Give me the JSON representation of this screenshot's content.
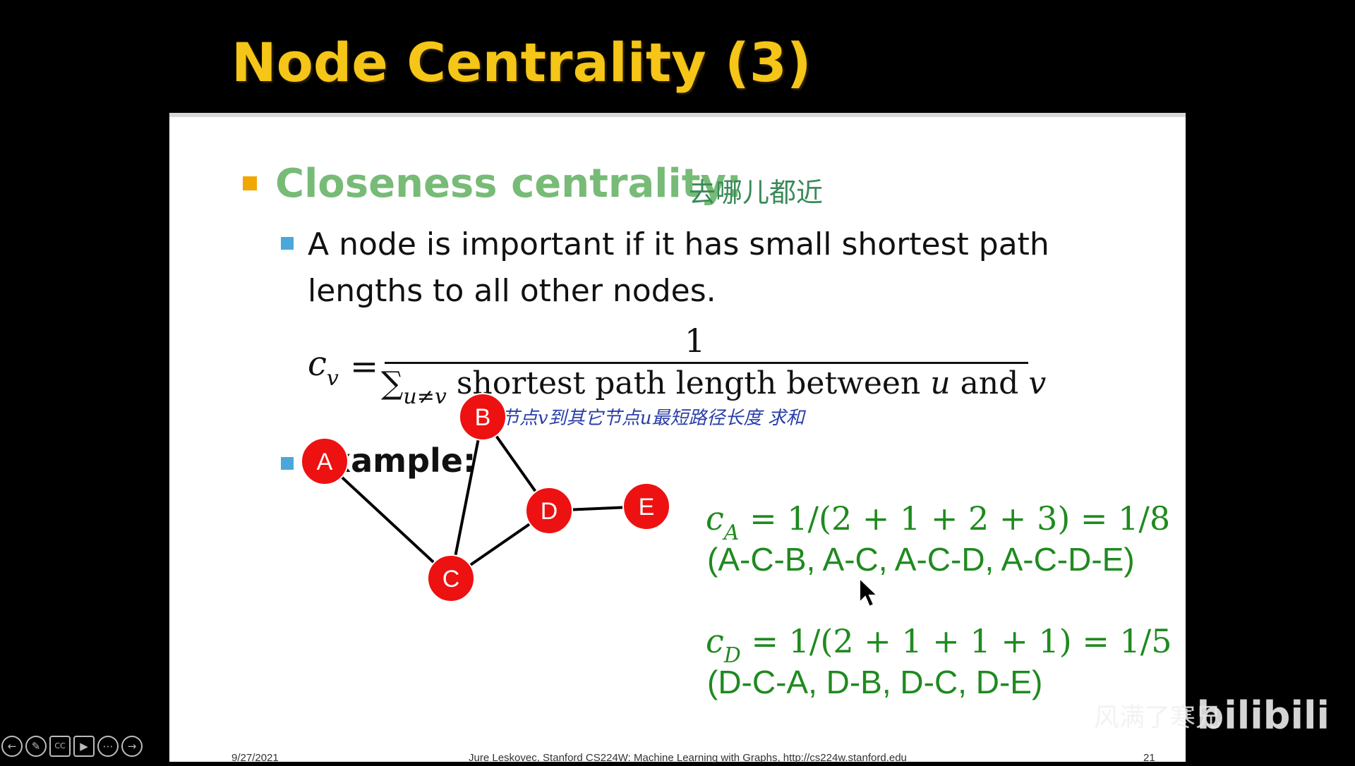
{
  "slide": {
    "title": "Node Centrality (3)",
    "heading": "Closeness centrality:",
    "heading_note": "去哪儿都近",
    "description": "A node is important if it has small shortest path lengths to all other nodes.",
    "formula": {
      "lhs": "c",
      "lhs_sub": "v",
      "equals": "=",
      "numerator": "1",
      "denominator_sum": "∑",
      "denominator_sub": "u≠v",
      "denominator_text": "shortest path length between",
      "var_u": "u",
      "and": "and",
      "var_v": "v",
      "note": "节点v到其它节点u最短路径长度 求和"
    },
    "example_label": "Example:",
    "graph": {
      "nodes": [
        "A",
        "B",
        "C",
        "D",
        "E"
      ],
      "edges": [
        [
          "A",
          "C"
        ],
        [
          "B",
          "C"
        ],
        [
          "B",
          "D"
        ],
        [
          "C",
          "D"
        ],
        [
          "D",
          "E"
        ]
      ],
      "node_color": "#ee1111"
    },
    "results": [
      {
        "lhs": "c",
        "sub": "A",
        "expr": "= 1/(2 + 1 + 2 + 3) = 1/8",
        "paths": "(A-C-B, A-C, A-C-D, A-C-D-E)"
      },
      {
        "lhs": "c",
        "sub": "D",
        "expr": "= 1/(2 + 1 + 1 + 1) = 1/5",
        "paths": "(D-C-A, D-B, D-C, D-E)"
      }
    ],
    "footer": {
      "date": "9/27/2021",
      "credit": "Jure Leskovec, Stanford CS224W: Machine Learning with Graphs, http://cs224w.stanford.edu",
      "page": "21"
    }
  },
  "colors": {
    "title": "#f5c518",
    "heading": "#77bb77",
    "bullet_main": "#f0a800",
    "bullet_sub": "#4aa8d8",
    "result_text": "#1f8a1f"
  },
  "toolbar": {
    "icons": [
      "back-icon",
      "pen-icon",
      "captions-icon",
      "video-off-icon",
      "more-icon",
      "forward-icon"
    ]
  },
  "watermark": {
    "uploader": "风满了寒兄",
    "brand": "bilibili"
  }
}
